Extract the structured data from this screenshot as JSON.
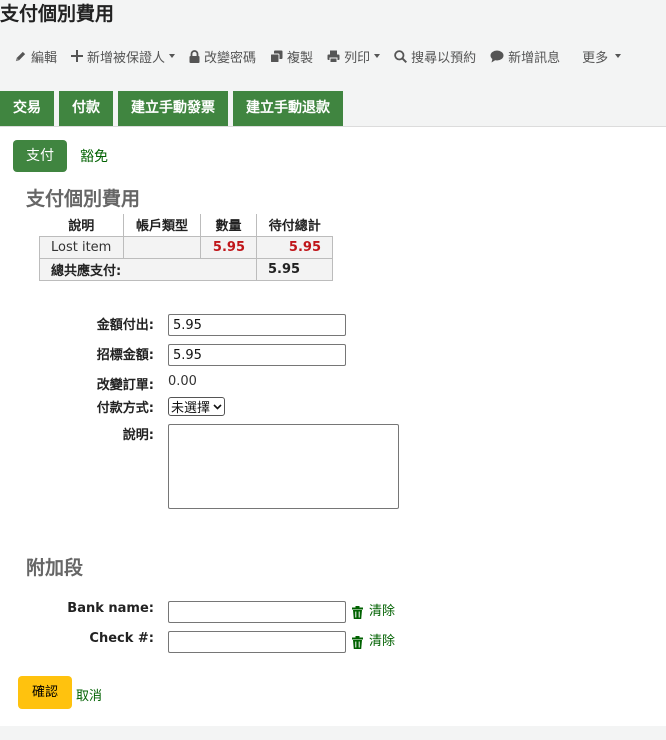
{
  "page": {
    "title": "支付個別費用"
  },
  "toolbar": {
    "edit": "編輯",
    "add_guarantee": "新增被保證人",
    "change_password": "改變密碼",
    "duplicate": "複製",
    "print": "列印",
    "search_to_hold": "搜尋以預約",
    "add_message": "新增訊息",
    "more": "更多"
  },
  "tabs": [
    "交易",
    "付款",
    "建立手動發票",
    "建立手動退款"
  ],
  "subtabs": {
    "pay": "支付",
    "writeoff": "豁免"
  },
  "fees_section": {
    "title": "支付個別費用",
    "headers": [
      "說明",
      "帳戶類型",
      "數量",
      "待付總計"
    ],
    "rows": [
      {
        "description": "Lost item",
        "account_type": "",
        "amount": "5.95",
        "outstanding": "5.95"
      }
    ],
    "total_label": "總共應支付:",
    "total_value": "5.95"
  },
  "form": {
    "amount_paid_label": "金額付出:",
    "amount_paid_value": "5.95",
    "amount_tendered_label": "招標金額:",
    "amount_tendered_value": "5.95",
    "change_label": "改變訂單:",
    "change_value": "0.00",
    "payment_type_label": "付款方式:",
    "payment_type_selected": "未選擇",
    "note_label": "說明:"
  },
  "extra_section": {
    "title": "附加段",
    "bank_name_label": "Bank name:",
    "check_label": "Check #:",
    "clear_label": "清除"
  },
  "actions": {
    "confirm": "確認",
    "cancel": "取消"
  },
  "colors": {
    "tab_green": "#408540",
    "link_green": "#006100",
    "confirm_yellow": "#ffc20e",
    "amount_red": "#c0161a"
  }
}
